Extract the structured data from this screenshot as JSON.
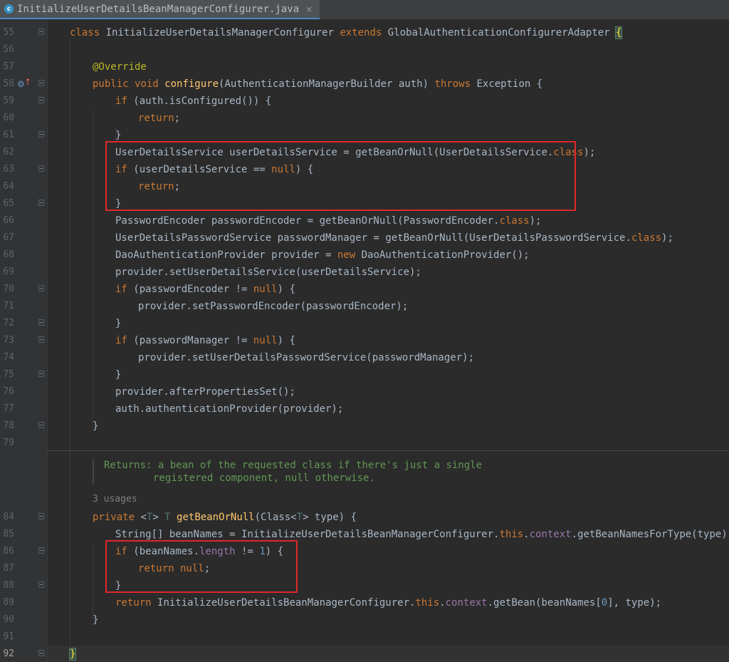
{
  "tab": {
    "title": "InitializeUserDetailsBeanManagerConfigurer.java",
    "close": "×",
    "icon_letter": "c"
  },
  "lines": [
    {
      "n": "55",
      "fold": true,
      "parts": [
        [
          "kw",
          "class "
        ],
        [
          "",
          "InitializeUserDetailsManagerConfigurer "
        ],
        [
          "kw",
          "extends "
        ],
        [
          "",
          "GlobalAuthenticationConfigurerAdapter "
        ],
        [
          "bracehl",
          "{"
        ]
      ]
    },
    {
      "n": "56",
      "parts": []
    },
    {
      "n": "57",
      "parts": [
        [
          "ann",
          "@Override"
        ]
      ]
    },
    {
      "n": "58",
      "fold": true,
      "override": true,
      "parts": [
        [
          "kw",
          "public void "
        ],
        [
          "fn",
          "configure"
        ],
        [
          "",
          "(AuthenticationManagerBuilder auth) "
        ],
        [
          "kw",
          "throws "
        ],
        [
          "",
          "Exception {"
        ]
      ]
    },
    {
      "n": "59",
      "fold": true,
      "parts": [
        [
          "kw",
          "if "
        ],
        [
          "",
          "(auth.isConfigured()) {"
        ]
      ]
    },
    {
      "n": "60",
      "parts": [
        [
          "kw",
          "return"
        ],
        [
          "",
          ";"
        ]
      ]
    },
    {
      "n": "61",
      "fold": true,
      "parts": [
        [
          "",
          "}"
        ]
      ]
    },
    {
      "n": "62",
      "parts": [
        [
          "",
          "UserDetailsService userDetailsService = getBeanOrNull(UserDetailsService."
        ],
        [
          "kw",
          "class"
        ],
        [
          "",
          ");"
        ]
      ]
    },
    {
      "n": "63",
      "fold": true,
      "parts": [
        [
          "kw",
          "if "
        ],
        [
          "",
          "(userDetailsService == "
        ],
        [
          "kw",
          "null"
        ],
        [
          "",
          ") {"
        ]
      ]
    },
    {
      "n": "64",
      "parts": [
        [
          "kw",
          "return"
        ],
        [
          "",
          ";"
        ]
      ]
    },
    {
      "n": "65",
      "fold": true,
      "parts": [
        [
          "",
          "}"
        ]
      ]
    },
    {
      "n": "66",
      "parts": [
        [
          "",
          "PasswordEncoder passwordEncoder = getBeanOrNull(PasswordEncoder."
        ],
        [
          "kw",
          "class"
        ],
        [
          "",
          ");"
        ]
      ]
    },
    {
      "n": "67",
      "parts": [
        [
          "",
          "UserDetailsPasswordService passwordManager = getBeanOrNull(UserDetailsPasswordService."
        ],
        [
          "kw",
          "class"
        ],
        [
          "",
          ");"
        ]
      ]
    },
    {
      "n": "68",
      "parts": [
        [
          "",
          "DaoAuthenticationProvider provider = "
        ],
        [
          "kw",
          "new "
        ],
        [
          "",
          "DaoAuthenticationProvider();"
        ]
      ]
    },
    {
      "n": "69",
      "parts": [
        [
          "",
          "provider.setUserDetailsService(userDetailsService);"
        ]
      ]
    },
    {
      "n": "70",
      "fold": true,
      "parts": [
        [
          "kw",
          "if "
        ],
        [
          "",
          "(passwordEncoder != "
        ],
        [
          "kw",
          "null"
        ],
        [
          "",
          ") {"
        ]
      ]
    },
    {
      "n": "71",
      "parts": [
        [
          "",
          "provider.setPasswordEncoder(passwordEncoder);"
        ]
      ]
    },
    {
      "n": "72",
      "fold": true,
      "parts": [
        [
          "",
          "}"
        ]
      ]
    },
    {
      "n": "73",
      "fold": true,
      "parts": [
        [
          "kw",
          "if "
        ],
        [
          "",
          "(passwordManager != "
        ],
        [
          "kw",
          "null"
        ],
        [
          "",
          ") {"
        ]
      ]
    },
    {
      "n": "74",
      "parts": [
        [
          "",
          "provider.setUserDetailsPasswordService(passwordManager);"
        ]
      ]
    },
    {
      "n": "75",
      "fold": true,
      "parts": [
        [
          "",
          "}"
        ]
      ]
    },
    {
      "n": "76",
      "parts": [
        [
          "",
          "provider.afterPropertiesSet();"
        ]
      ]
    },
    {
      "n": "77",
      "parts": [
        [
          "",
          "auth.authenticationProvider(provider);"
        ]
      ]
    },
    {
      "n": "78",
      "fold": true,
      "parts": [
        [
          "",
          "}"
        ]
      ]
    },
    {
      "n": "79",
      "parts": []
    },
    {
      "n": "84",
      "fold": true,
      "parts": [
        [
          "kw",
          "private "
        ],
        [
          "",
          "<"
        ],
        [
          "tp",
          "T"
        ],
        [
          "",
          "> "
        ],
        [
          "tp",
          "T "
        ],
        [
          "fn",
          "getBeanOrNull"
        ],
        [
          "",
          "(Class<"
        ],
        [
          "tp",
          "T"
        ],
        [
          "",
          "> type) {"
        ]
      ]
    },
    {
      "n": "85",
      "parts": [
        [
          "",
          "String[] beanNames = InitializeUserDetailsBeanManagerConfigurer."
        ],
        [
          "kw",
          "this"
        ],
        [
          "",
          "."
        ],
        [
          "fld",
          "context"
        ],
        [
          "",
          ".getBeanNamesForType(type);"
        ]
      ]
    },
    {
      "n": "86",
      "fold": true,
      "parts": [
        [
          "kw",
          "if "
        ],
        [
          "",
          "(beanNames."
        ],
        [
          "fld",
          "length"
        ],
        [
          "",
          " != "
        ],
        [
          "num",
          "1"
        ],
        [
          "",
          ") {"
        ]
      ]
    },
    {
      "n": "87",
      "parts": [
        [
          "kw",
          "return null"
        ],
        [
          "",
          ";"
        ]
      ]
    },
    {
      "n": "88",
      "fold": true,
      "parts": [
        [
          "",
          "}"
        ]
      ]
    },
    {
      "n": "89",
      "parts": [
        [
          "kw",
          "return "
        ],
        [
          "",
          "InitializeUserDetailsBeanManagerConfigurer."
        ],
        [
          "kw",
          "this"
        ],
        [
          "",
          "."
        ],
        [
          "fld",
          "context"
        ],
        [
          "",
          ".getBean(beanNames["
        ],
        [
          "num",
          "0"
        ],
        [
          "",
          "], type);"
        ]
      ]
    },
    {
      "n": "90",
      "parts": [
        [
          "",
          "}"
        ]
      ]
    },
    {
      "n": "91",
      "parts": []
    },
    {
      "n": "92",
      "fold": true,
      "current": true,
      "parts": [
        [
          "bracehl",
          "}"
        ]
      ]
    }
  ],
  "javadoc": {
    "returns_label": "Returns:",
    "line1": "a bean of the requested class if there's just a single",
    "line2": "registered component, null otherwise."
  },
  "usages": "3 usages"
}
